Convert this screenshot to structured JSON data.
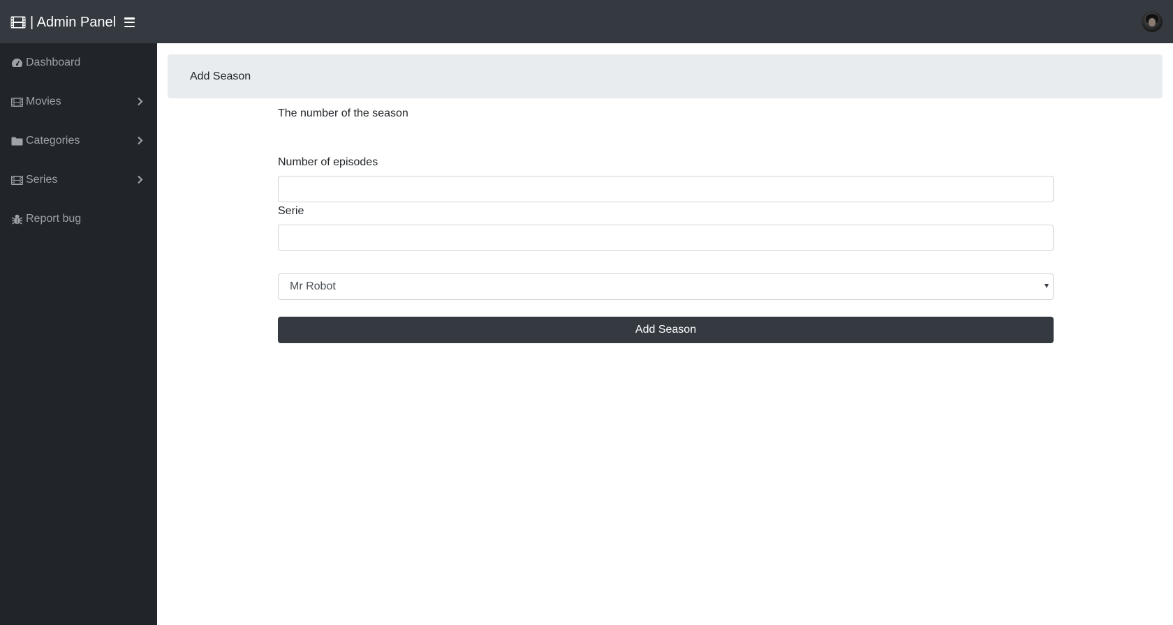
{
  "app": {
    "brand_title": "| Admin Panel",
    "brand_icon": "film-icon",
    "menu_icon": "hamburger-icon"
  },
  "sidebar": {
    "items": [
      {
        "label": "Dashboard",
        "icon": "tachometer-icon",
        "has_submenu": false
      },
      {
        "label": "Movies",
        "icon": "film-icon",
        "has_submenu": true
      },
      {
        "label": "Categories",
        "icon": "folder-icon",
        "has_submenu": true
      },
      {
        "label": "Series",
        "icon": "film-icon",
        "has_submenu": true
      },
      {
        "label": "Report bug",
        "icon": "bug-icon",
        "has_submenu": false
      }
    ]
  },
  "page": {
    "title": "Add Season"
  },
  "form": {
    "season_number_label": "The number of the season",
    "season_number_value": "",
    "episodes_label": "Number of episodes",
    "episodes_value": "",
    "serie_label": "Serie",
    "serie_selected": "Mr Robot",
    "submit_label": "Add Season"
  },
  "colors": {
    "topbar": "#343a40",
    "sidebar": "#212529",
    "sidebar_text": "#9ea2a6",
    "header_panel": "#e9ecef",
    "button": "#343a40"
  }
}
